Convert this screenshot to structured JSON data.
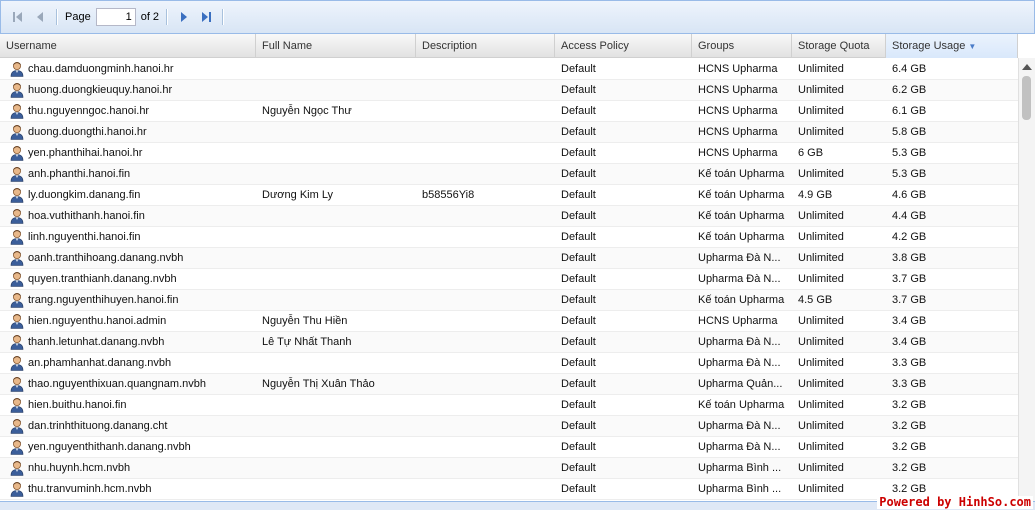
{
  "paging": {
    "page_label": "Page",
    "current_page": "1",
    "of_label": "of 2"
  },
  "columns": [
    {
      "key": "username",
      "label": "Username"
    },
    {
      "key": "full_name",
      "label": "Full Name"
    },
    {
      "key": "description",
      "label": "Description"
    },
    {
      "key": "access_policy",
      "label": "Access Policy"
    },
    {
      "key": "groups",
      "label": "Groups"
    },
    {
      "key": "storage_quota",
      "label": "Storage Quota"
    },
    {
      "key": "storage_usage",
      "label": "Storage Usage"
    }
  ],
  "sort": {
    "column": "storage_usage",
    "direction": "desc",
    "icon": "sort-desc-icon"
  },
  "rows": [
    {
      "username": "chau.damduongminh.hanoi.hr",
      "full_name": "",
      "description": "",
      "access_policy": "Default",
      "groups": "HCNS Upharma",
      "storage_quota": "Unlimited",
      "storage_usage": "6.4 GB"
    },
    {
      "username": "huong.duongkieuquy.hanoi.hr",
      "full_name": "",
      "description": "",
      "access_policy": "Default",
      "groups": "HCNS Upharma",
      "storage_quota": "Unlimited",
      "storage_usage": "6.2 GB"
    },
    {
      "username": "thu.nguyenngoc.hanoi.hr",
      "full_name": "Nguyễn Ngọc Thư",
      "description": "",
      "access_policy": "Default",
      "groups": "HCNS Upharma",
      "storage_quota": "Unlimited",
      "storage_usage": "6.1 GB"
    },
    {
      "username": "duong.duongthi.hanoi.hr",
      "full_name": "",
      "description": "",
      "access_policy": "Default",
      "groups": "HCNS Upharma",
      "storage_quota": "Unlimited",
      "storage_usage": "5.8 GB"
    },
    {
      "username": "yen.phanthihai.hanoi.hr",
      "full_name": "",
      "description": "",
      "access_policy": "Default",
      "groups": "HCNS Upharma",
      "storage_quota": "6 GB",
      "storage_usage": "5.3 GB"
    },
    {
      "username": "anh.phanthi.hanoi.fin",
      "full_name": "",
      "description": "",
      "access_policy": "Default",
      "groups": "Kế toán Upharma",
      "storage_quota": "Unlimited",
      "storage_usage": "5.3 GB"
    },
    {
      "username": "ly.duongkim.danang.fin",
      "full_name": "Dương Kim Ly",
      "description": "b58556Yi8",
      "access_policy": "Default",
      "groups": "Kế toán Upharma",
      "storage_quota": "4.9 GB",
      "storage_usage": "4.6 GB"
    },
    {
      "username": "hoa.vuthithanh.hanoi.fin",
      "full_name": "",
      "description": "",
      "access_policy": "Default",
      "groups": "Kế toán Upharma",
      "storage_quota": "Unlimited",
      "storage_usage": "4.4 GB"
    },
    {
      "username": "linh.nguyenthi.hanoi.fin",
      "full_name": "",
      "description": "",
      "access_policy": "Default",
      "groups": "Kế toán Upharma",
      "storage_quota": "Unlimited",
      "storage_usage": "4.2 GB"
    },
    {
      "username": "oanh.tranthihoang.danang.nvbh",
      "full_name": "",
      "description": "",
      "access_policy": "Default",
      "groups": "Upharma Đà N...",
      "storage_quota": "Unlimited",
      "storage_usage": "3.8 GB"
    },
    {
      "username": "quyen.tranthianh.danang.nvbh",
      "full_name": "",
      "description": "",
      "access_policy": "Default",
      "groups": "Upharma Đà N...",
      "storage_quota": "Unlimited",
      "storage_usage": "3.7 GB"
    },
    {
      "username": "trang.nguyenthihuyen.hanoi.fin",
      "full_name": "",
      "description": "",
      "access_policy": "Default",
      "groups": "Kế toán Upharma",
      "storage_quota": "4.5 GB",
      "storage_usage": "3.7 GB"
    },
    {
      "username": "hien.nguyenthu.hanoi.admin",
      "full_name": "Nguyễn Thu Hiền",
      "description": "",
      "access_policy": "Default",
      "groups": "HCNS Upharma",
      "storage_quota": "Unlimited",
      "storage_usage": "3.4 GB"
    },
    {
      "username": "thanh.letunhat.danang.nvbh",
      "full_name": "Lê Tự Nhất Thanh",
      "description": "",
      "access_policy": "Default",
      "groups": "Upharma Đà N...",
      "storage_quota": "Unlimited",
      "storage_usage": "3.4 GB"
    },
    {
      "username": "an.phamhanhat.danang.nvbh",
      "full_name": "",
      "description": "",
      "access_policy": "Default",
      "groups": "Upharma Đà N...",
      "storage_quota": "Unlimited",
      "storage_usage": "3.3 GB"
    },
    {
      "username": "thao.nguyenthixuan.quangnam.nvbh",
      "full_name": "Nguyễn Thị Xuân Thảo",
      "description": "",
      "access_policy": "Default",
      "groups": "Upharma Quản...",
      "storage_quota": "Unlimited",
      "storage_usage": "3.3 GB"
    },
    {
      "username": "hien.buithu.hanoi.fin",
      "full_name": "",
      "description": "",
      "access_policy": "Default",
      "groups": "Kế toán Upharma",
      "storage_quota": "Unlimited",
      "storage_usage": "3.2 GB"
    },
    {
      "username": "dan.trinhthituong.danang.cht",
      "full_name": "",
      "description": "",
      "access_policy": "Default",
      "groups": "Upharma Đà N...",
      "storage_quota": "Unlimited",
      "storage_usage": "3.2 GB"
    },
    {
      "username": "yen.nguyenthithanh.danang.nvbh",
      "full_name": "",
      "description": "",
      "access_policy": "Default",
      "groups": "Upharma Đà N...",
      "storage_quota": "Unlimited",
      "storage_usage": "3.2 GB"
    },
    {
      "username": "nhu.huynh.hcm.nvbh",
      "full_name": "",
      "description": "",
      "access_policy": "Default",
      "groups": "Upharma Bình ...",
      "storage_quota": "Unlimited",
      "storage_usage": "3.2 GB"
    },
    {
      "username": "thu.tranvuminh.hcm.nvbh",
      "full_name": "",
      "description": "",
      "access_policy": "Default",
      "groups": "Upharma Bình ...",
      "storage_quota": "Unlimited",
      "storage_usage": "3.2 GB"
    }
  ],
  "watermark": "Powered by HinhSo.com",
  "colors": {
    "watermark": "#cc0000",
    "header_border": "#99bbe8",
    "sorted_header": "#d9e8fb"
  }
}
